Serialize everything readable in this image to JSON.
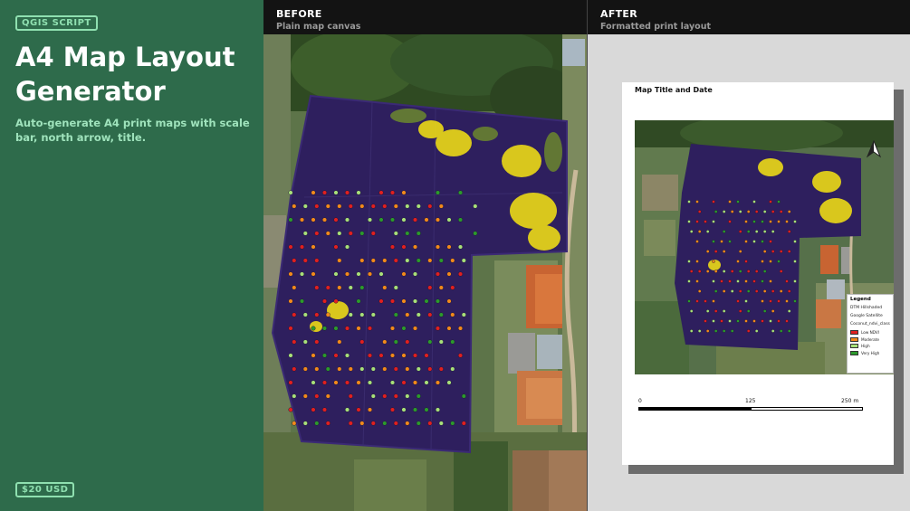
{
  "badge": "QGIS SCRIPT",
  "title": "A4 Map Layout Generator",
  "subtitle": "Auto-generate A4 print maps with scale bar, north arrow, title.",
  "price": "$20 USD",
  "before": {
    "heading": "BEFORE",
    "caption": "Plain map canvas"
  },
  "after": {
    "heading": "AFTER",
    "caption": "Formatted print layout"
  },
  "layout": {
    "map_title": "Map Title and Date",
    "legend": {
      "title": "Legend",
      "layers": [
        "DTM Hillshaded",
        "Google Satellite",
        "Coconut_ndvi_class"
      ],
      "classes": [
        {
          "label": "Low NDVI",
          "color": "#e02020"
        },
        {
          "label": "Moderate",
          "color": "#f28a1b"
        },
        {
          "label": "High",
          "color": "#a8e07a"
        },
        {
          "label": "Very High",
          "color": "#2c9a2c"
        }
      ]
    },
    "scale_bar": {
      "labels": [
        "0",
        "125",
        "250 m"
      ]
    },
    "north_arrow": "north-arrow-icon"
  },
  "colors": {
    "panel_bg": "#2e6b4b",
    "accent": "#8fe0b0",
    "header_bg": "#131313",
    "field_purple": "#2e1f5e",
    "canopy_yellow": "#e3d11a"
  }
}
